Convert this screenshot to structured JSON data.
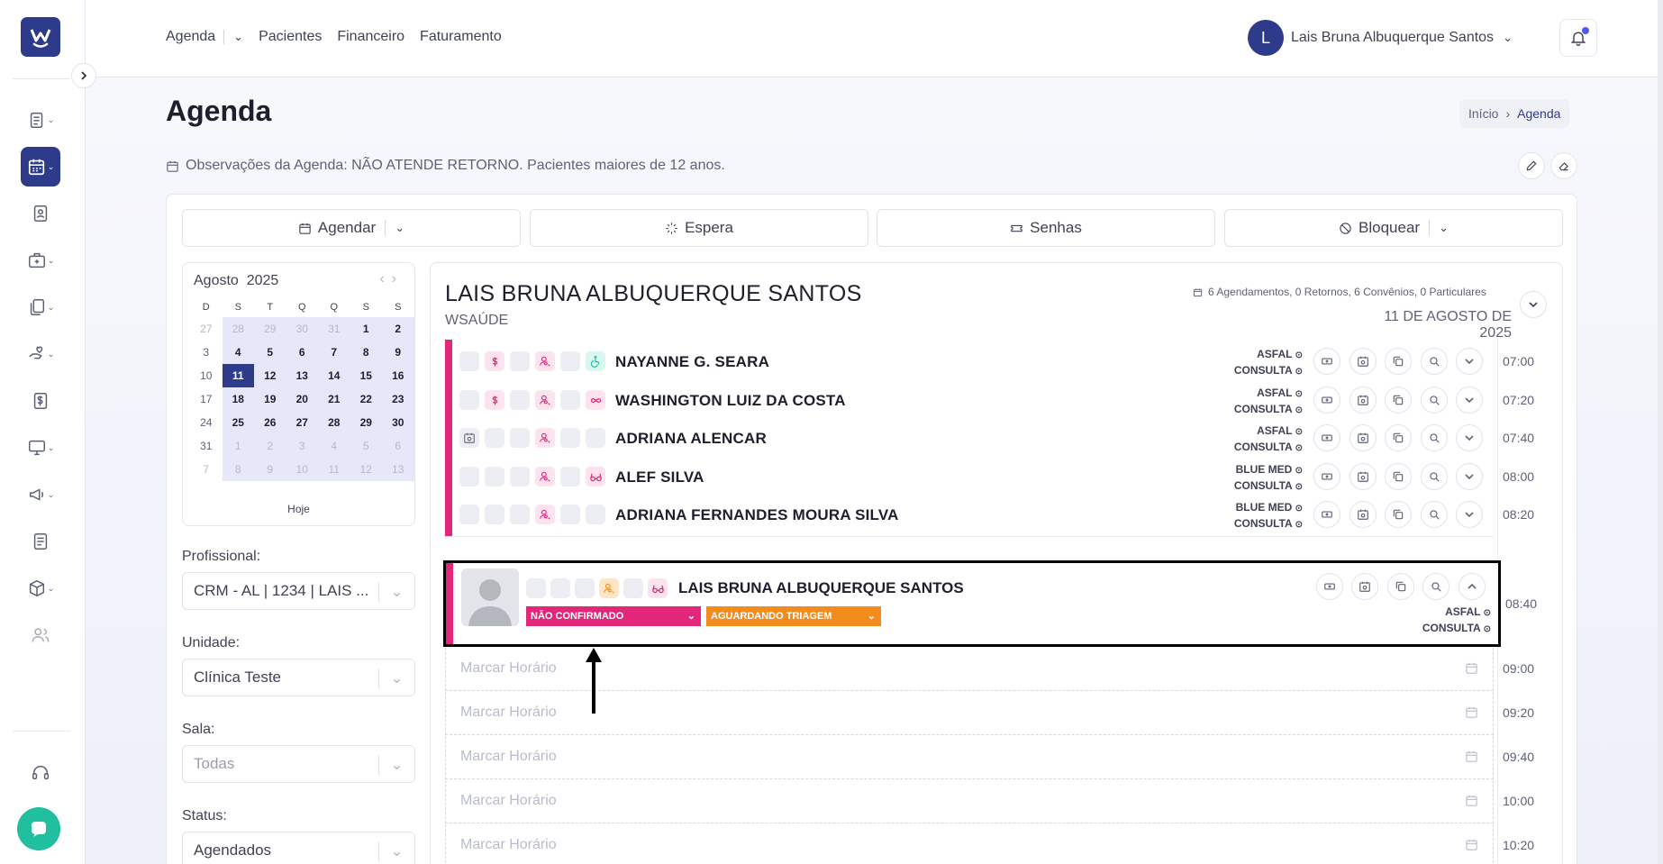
{
  "nav": {
    "agenda": "Agenda",
    "pacientes": "Pacientes",
    "financeiro": "Financeiro",
    "faturamento": "Faturamento"
  },
  "user": {
    "initial": "L",
    "name": "Lais Bruna Albuquerque Santos"
  },
  "page": {
    "title": "Agenda",
    "breadcrumb_home": "Início",
    "breadcrumb_current": "Agenda",
    "observacoes": "Observações da Agenda: NÃO ATENDE RETORNO. Pacientes maiores de 12 anos."
  },
  "actions": {
    "agendar": "Agendar",
    "espera": "Espera",
    "senhas": "Senhas",
    "bloquear": "Bloquear"
  },
  "calendar": {
    "month": "Agosto",
    "year": "2025",
    "today_label": "Hoje",
    "dow": [
      "D",
      "S",
      "T",
      "Q",
      "Q",
      "S",
      "S"
    ],
    "weeks": [
      [
        "27",
        "28",
        "29",
        "30",
        "31",
        "1",
        "2"
      ],
      [
        "3",
        "4",
        "5",
        "6",
        "7",
        "8",
        "9"
      ],
      [
        "10",
        "11",
        "12",
        "13",
        "14",
        "15",
        "16"
      ],
      [
        "17",
        "18",
        "19",
        "20",
        "21",
        "22",
        "23"
      ],
      [
        "24",
        "25",
        "26",
        "27",
        "28",
        "29",
        "30"
      ],
      [
        "31",
        "1",
        "2",
        "3",
        "4",
        "5",
        "6"
      ],
      [
        "7",
        "8",
        "9",
        "10",
        "11",
        "12",
        "13"
      ]
    ]
  },
  "filters": {
    "profissional_label": "Profissional:",
    "profissional_value": "CRM - AL | 1234 | LAIS ...",
    "unidade_label": "Unidade:",
    "unidade_value": "Clínica Teste",
    "sala_label": "Sala:",
    "sala_value": "Todas",
    "status_label": "Status:",
    "status_value": "Agendados"
  },
  "agenda": {
    "professional": "LAIS BRUNA ALBUQUERQUE SANTOS",
    "clinic": "WSAÚDE",
    "stats": "6 Agendamentos, 0 Retornos, 6 Convênios, 0 Particulares",
    "date": "11 DE AGOSTO DE 2025",
    "appointments": [
      {
        "name": "NAYANNE G. SEARA",
        "insurance": "ASFAL",
        "type": "CONSULTA",
        "time": "07:00"
      },
      {
        "name": "WASHINGTON LUIZ DA COSTA",
        "insurance": "ASFAL",
        "type": "CONSULTA",
        "time": "07:20"
      },
      {
        "name": "ADRIANA ALENCAR",
        "insurance": "ASFAL",
        "type": "CONSULTA",
        "time": "07:40"
      },
      {
        "name": "ALEF SILVA",
        "insurance": "BLUE MED",
        "type": "CONSULTA",
        "time": "08:00"
      },
      {
        "name": "ADRIANA FERNANDES MOURA SILVA",
        "insurance": "BLUE MED",
        "type": "CONSULTA",
        "time": "08:20"
      }
    ],
    "expanded": {
      "name": "LAIS BRUNA ALBUQUERQUE SANTOS",
      "insurance": "ASFAL",
      "type": "CONSULTA",
      "time": "08:40",
      "confirm_status": "NÃO CONFIRMADO",
      "triage_status": "AGUARDANDO TRIAGEM"
    },
    "empty_slot_label": "Marcar Horário",
    "empty_times": [
      "09:00",
      "09:20",
      "09:40",
      "10:00",
      "10:20"
    ]
  },
  "colors": {
    "brand": "#2e3a8a",
    "accent_pink": "#e2277b",
    "accent_orange": "#f28c1c",
    "chat": "#1fbf9f"
  }
}
